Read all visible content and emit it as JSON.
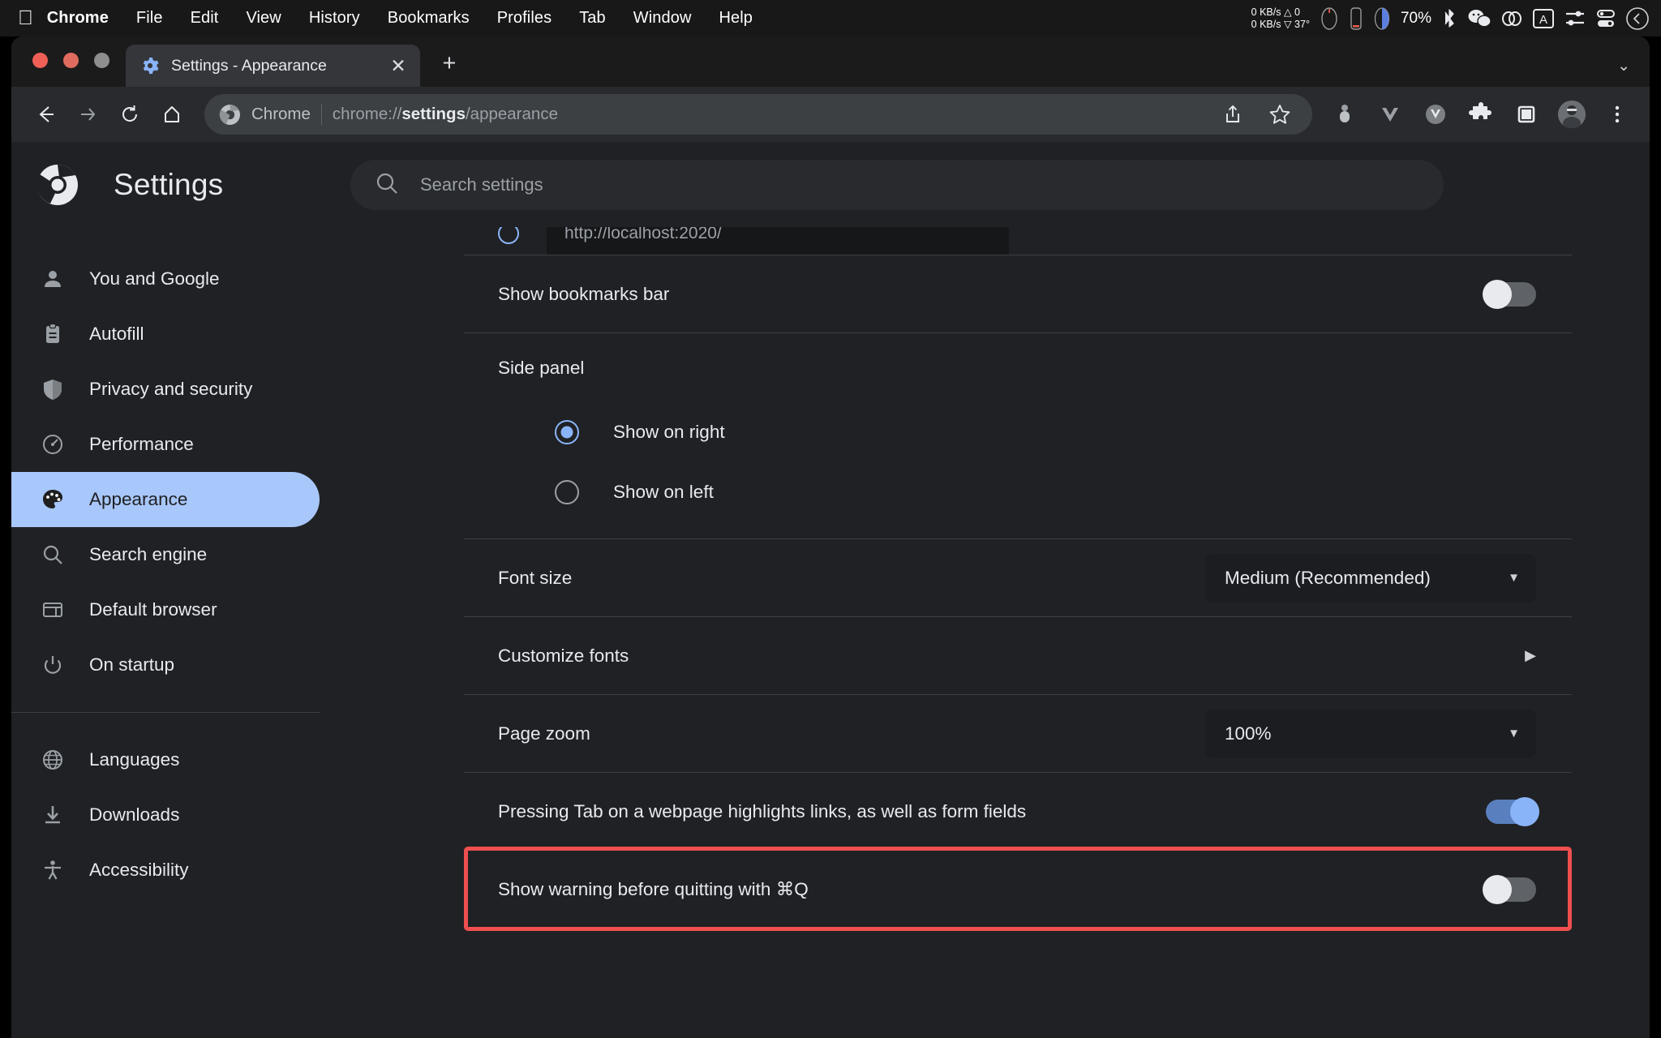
{
  "menubar": {
    "apple_icon": "apple-logo",
    "items": [
      {
        "label": "Chrome",
        "bold": true
      },
      {
        "label": "File",
        "bold": false
      },
      {
        "label": "Edit",
        "bold": false
      },
      {
        "label": "View",
        "bold": false
      },
      {
        "label": "History",
        "bold": false
      },
      {
        "label": "Bookmarks",
        "bold": false
      },
      {
        "label": "Profiles",
        "bold": false
      },
      {
        "label": "Tab",
        "bold": false
      },
      {
        "label": "Window",
        "bold": false
      },
      {
        "label": "Help",
        "bold": false
      }
    ],
    "status": {
      "net_up": "0 KB/s △ 0",
      "net_down": "0 KB/s ▽ 37°",
      "battery_percent": "70%",
      "icons": [
        "cpu-gauge-icon",
        "battery-icon",
        "battery-fill-icon",
        "bluetooth-icon",
        "wechat-icon",
        "link-icon",
        "input-source-icon",
        "control-center-icon",
        "display-icon",
        "siri-icon"
      ]
    }
  },
  "window": {
    "traffic_lights": [
      "close-button",
      "minimize-button",
      "zoom-button"
    ],
    "tab": {
      "favicon": "settings-gear-icon",
      "title": "Settings - Appearance",
      "close_label": "✕"
    },
    "new_tab_label": "+",
    "tabstrip_chevron": "⌄"
  },
  "toolbar": {
    "back_label": "back-arrow-icon",
    "forward_label": "forward-arrow-icon",
    "reload_label": "reload-icon",
    "home_label": "home-icon",
    "omnibox": {
      "chrome_chip": "Chrome",
      "url_prefix": "chrome://",
      "url_bold": "settings",
      "url_suffix": "/appearance"
    },
    "actions": [
      "share-icon",
      "bookmark-star-icon"
    ],
    "right_icons": [
      "extension-pill-icon",
      "vimium-v-icon",
      "vue-devtools-icon",
      "puzzle-extensions-icon",
      "side-panel-icon"
    ],
    "avatar": "profile-avatar",
    "menu": "three-dot-menu-icon"
  },
  "settings": {
    "logo": "chrome-logo-icon",
    "title": "Settings",
    "search": {
      "icon": "search-icon",
      "placeholder": "Search settings"
    },
    "sidebar": {
      "items": [
        {
          "label": "You and Google",
          "icon": "person-icon",
          "active": false
        },
        {
          "label": "Autofill",
          "icon": "clipboard-icon",
          "active": false
        },
        {
          "label": "Privacy and security",
          "icon": "shield-icon",
          "active": false
        },
        {
          "label": "Performance",
          "icon": "speedometer-icon",
          "active": false
        },
        {
          "label": "Appearance",
          "icon": "palette-icon",
          "active": true
        },
        {
          "label": "Search engine",
          "icon": "magnifier-icon",
          "active": false
        },
        {
          "label": "Default browser",
          "icon": "browser-window-icon",
          "active": false
        },
        {
          "label": "On startup",
          "icon": "power-icon",
          "active": false
        }
      ],
      "items2": [
        {
          "label": "Languages",
          "icon": "globe-icon",
          "active": false
        },
        {
          "label": "Downloads",
          "icon": "download-icon",
          "active": false
        },
        {
          "label": "Accessibility",
          "icon": "accessibility-icon",
          "active": false
        }
      ]
    },
    "content": {
      "partial_row": {
        "input_value": "http://localhost:2020/"
      },
      "bookmarks_bar": {
        "label": "Show bookmarks bar",
        "toggle": "off"
      },
      "side_panel": {
        "heading": "Side panel",
        "options": [
          {
            "label": "Show on right",
            "selected": true
          },
          {
            "label": "Show on left",
            "selected": false
          }
        ]
      },
      "font_size": {
        "label": "Font size",
        "value": "Medium (Recommended)",
        "caret": "▼"
      },
      "customize_fonts": {
        "label": "Customize fonts",
        "chevron": "▶"
      },
      "page_zoom": {
        "label": "Page zoom",
        "value": "100%",
        "caret": "▼"
      },
      "tab_highlight": {
        "label": "Pressing Tab on a webpage highlights links, as well as form fields",
        "toggle": "on"
      },
      "quit_warning": {
        "label": "Show warning before quitting with ⌘Q",
        "toggle": "off",
        "highlighted": true
      }
    }
  },
  "colors": {
    "accent_blue": "#8ab4f8",
    "sidebar_active_bg": "#a8c7fa",
    "highlight_red": "#ef4f4f",
    "page_bg": "#202124"
  }
}
